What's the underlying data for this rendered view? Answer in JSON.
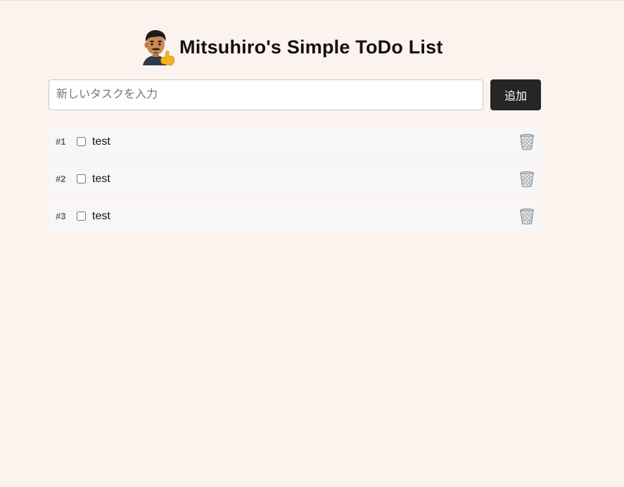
{
  "header": {
    "avatar_icon": "memoji-thumbs-up-icon",
    "title": "Mitsuhiro's Simple ToDo List"
  },
  "new_task": {
    "placeholder": "新しいタスクを入力",
    "value": "",
    "add_label": "追加"
  },
  "todos": [
    {
      "number": "#1",
      "text": "test",
      "checked": false,
      "delete_icon": "trash-can-icon"
    },
    {
      "number": "#2",
      "text": "test",
      "checked": false,
      "delete_icon": "trash-can-icon"
    },
    {
      "number": "#3",
      "text": "test",
      "checked": false,
      "delete_icon": "trash-can-icon"
    }
  ],
  "colors": {
    "background": "#fdf3ee",
    "button": "#262626",
    "item_background": "#f7f7f7"
  }
}
